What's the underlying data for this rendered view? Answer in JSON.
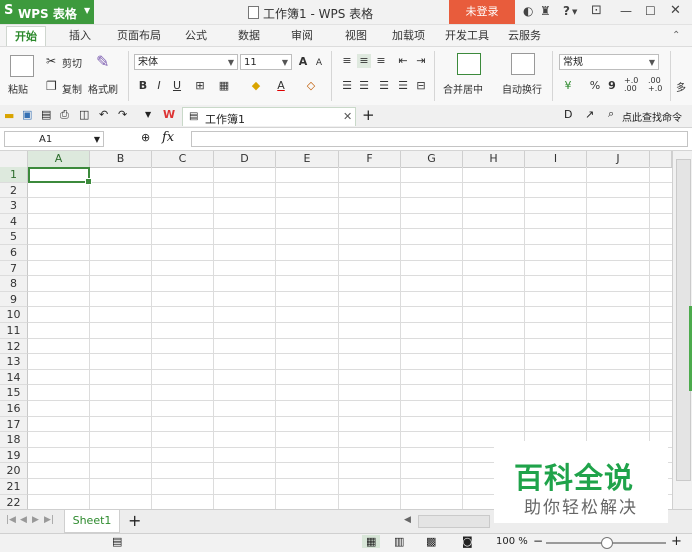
{
  "titlebar": {
    "app_name": "WPS 表格",
    "doc_title": "工作簿1 - WPS 表格",
    "login_button": "未登录",
    "help_icon_label": "?"
  },
  "menu_tabs": [
    "开始",
    "插入",
    "页面布局",
    "公式",
    "数据",
    "审阅",
    "视图",
    "加载项",
    "开发工具",
    "云服务"
  ],
  "ribbon": {
    "paste": "粘贴",
    "cut": "剪切",
    "copy": "复制",
    "format_painter": "格式刷",
    "font_name": "宋体",
    "font_size": "11",
    "bold": "B",
    "italic": "I",
    "underline": "U",
    "merge_center": "合并居中",
    "wrap_text": "自动换行",
    "number_format": "常规",
    "percent": "%",
    "comma": "9",
    "inc_decimal": "+.0 .00",
    "dec_decimal": ".00 +.0"
  },
  "toolbar2": {
    "doc_tab": "工作簿1",
    "find_command": "点此查找命令"
  },
  "formula_bar": {
    "cell_ref": "A1",
    "fx": "fx",
    "value": ""
  },
  "grid": {
    "columns": [
      "A",
      "B",
      "C",
      "D",
      "E",
      "F",
      "G",
      "H",
      "I",
      "J"
    ],
    "rows": [
      "1",
      "2",
      "3",
      "4",
      "5",
      "6",
      "7",
      "8",
      "9",
      "10",
      "11",
      "12",
      "13",
      "14",
      "15",
      "16",
      "17",
      "18",
      "19",
      "20",
      "21",
      "22"
    ],
    "active_cell": "A1"
  },
  "sheets": [
    "Sheet1"
  ],
  "statusbar": {
    "zoom": "100 %"
  },
  "watermark": {
    "title": "百科全说",
    "subtitle": "助你轻松解决"
  },
  "colors": {
    "accent_green": "#3d9a3d",
    "login_red": "#e85c3c",
    "watermark_green": "#1fa34a"
  }
}
